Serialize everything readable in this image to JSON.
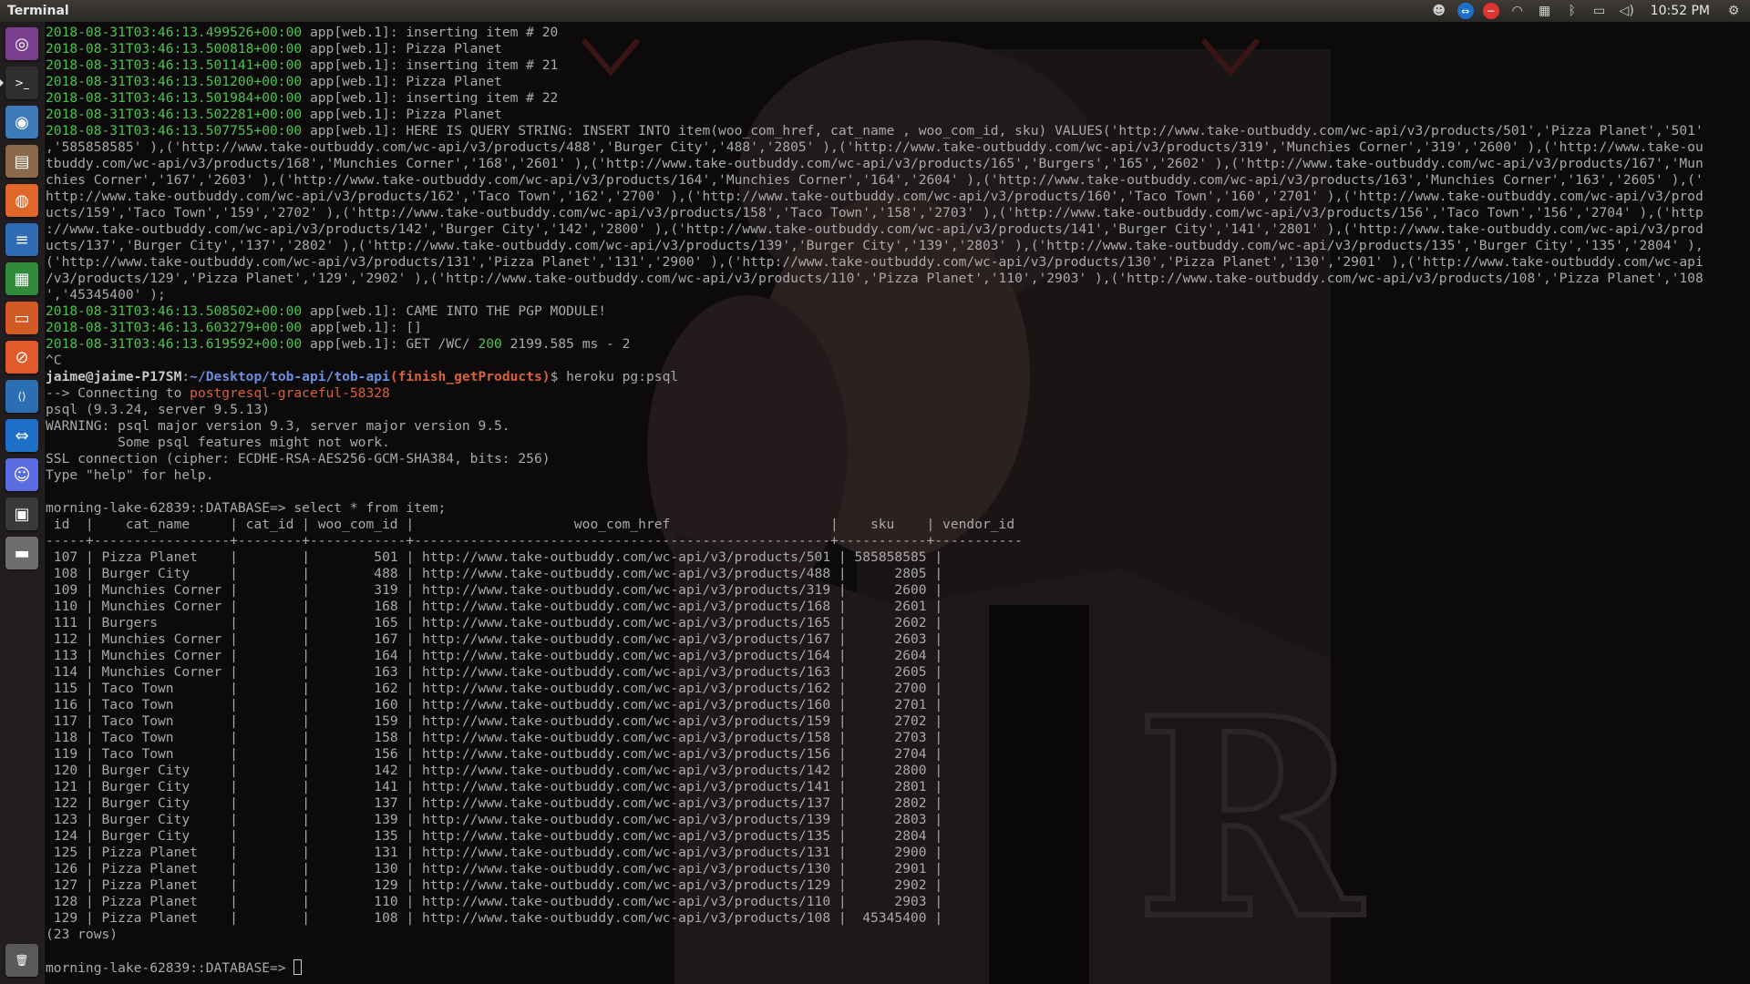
{
  "window": {
    "title": "Terminal"
  },
  "tray": {
    "clock": "10:52 PM"
  },
  "launcher": {
    "items": [
      {
        "name": "dash-icon",
        "color": "#7a3f8e",
        "glyph": "◎"
      },
      {
        "name": "terminal-icon",
        "color": "#2f2f2f",
        "glyph": ">_"
      },
      {
        "name": "chromium-icon",
        "color": "#3d7ab8",
        "glyph": "◉"
      },
      {
        "name": "files-icon",
        "color": "#8a6a4a",
        "glyph": "▤"
      },
      {
        "name": "firefox-icon",
        "color": "#e0662a",
        "glyph": "◍"
      },
      {
        "name": "writer-icon",
        "color": "#2e6db5",
        "glyph": "≡"
      },
      {
        "name": "calc-icon",
        "color": "#2f8b3b",
        "glyph": "▦"
      },
      {
        "name": "impress-icon",
        "color": "#d15a23",
        "glyph": "▭"
      },
      {
        "name": "compass-icon",
        "color": "#e25a2b",
        "glyph": "⊘"
      },
      {
        "name": "vscode-icon",
        "color": "#2a6fb4",
        "glyph": "⟨⟩"
      },
      {
        "name": "teamviewer-icon",
        "color": "#1d6fc8",
        "glyph": "⇔"
      },
      {
        "name": "discord-icon",
        "color": "#5b6ee1",
        "glyph": "☺"
      },
      {
        "name": "system-icon",
        "color": "#3a3a3a",
        "glyph": "▣"
      },
      {
        "name": "drive-icon",
        "color": "#6e6e6e",
        "glyph": "▬"
      },
      {
        "name": "trash-icon",
        "color": "#5a5a5a",
        "glyph": "🗑"
      }
    ]
  },
  "terminal": {
    "log_lines": [
      {
        "ts": "2018-08-31T03:46:13.499526+00:00",
        "rest": " app[web.1]: inserting item # 20"
      },
      {
        "ts": "2018-08-31T03:46:13.500818+00:00",
        "rest": " app[web.1]: Pizza Planet"
      },
      {
        "ts": "2018-08-31T03:46:13.501141+00:00",
        "rest": " app[web.1]: inserting item # 21"
      },
      {
        "ts": "2018-08-31T03:46:13.501200+00:00",
        "rest": " app[web.1]: Pizza Planet"
      },
      {
        "ts": "2018-08-31T03:46:13.501984+00:00",
        "rest": " app[web.1]: inserting item # 22"
      },
      {
        "ts": "2018-08-31T03:46:13.502281+00:00",
        "rest": " app[web.1]: Pizza Planet"
      },
      {
        "ts": "2018-08-31T03:46:13.507755+00:00",
        "rest": " app[web.1]: HERE IS QUERY STRING: INSERT INTO item(woo_com_href, cat_name , woo_com_id, sku) VALUES('http://www.take-outbuddy.com/wc-api/v3/products/501','Pizza Planet','501'"
      }
    ],
    "query_wrap": [
      ",'585858585' ),('http://www.take-outbuddy.com/wc-api/v3/products/488','Burger City','488','2805' ),('http://www.take-outbuddy.com/wc-api/v3/products/319','Munchies Corner','319','2600' ),('http://www.take-ou",
      "tbuddy.com/wc-api/v3/products/168','Munchies Corner','168','2601' ),('http://www.take-outbuddy.com/wc-api/v3/products/165','Burgers','165','2602' ),('http://www.take-outbuddy.com/wc-api/v3/products/167','Mun",
      "chies Corner','167','2603' ),('http://www.take-outbuddy.com/wc-api/v3/products/164','Munchies Corner','164','2604' ),('http://www.take-outbuddy.com/wc-api/v3/products/163','Munchies Corner','163','2605' ),('",
      "http://www.take-outbuddy.com/wc-api/v3/products/162','Taco Town','162','2700' ),('http://www.take-outbuddy.com/wc-api/v3/products/160','Taco Town','160','2701' ),('http://www.take-outbuddy.com/wc-api/v3/prod",
      "ucts/159','Taco Town','159','2702' ),('http://www.take-outbuddy.com/wc-api/v3/products/158','Taco Town','158','2703' ),('http://www.take-outbuddy.com/wc-api/v3/products/156','Taco Town','156','2704' ),('http",
      "://www.take-outbuddy.com/wc-api/v3/products/142','Burger City','142','2800' ),('http://www.take-outbuddy.com/wc-api/v3/products/141','Burger City','141','2801' ),('http://www.take-outbuddy.com/wc-api/v3/prod",
      "ucts/137','Burger City','137','2802' ),('http://www.take-outbuddy.com/wc-api/v3/products/139','Burger City','139','2803' ),('http://www.take-outbuddy.com/wc-api/v3/products/135','Burger City','135','2804' ),",
      "('http://www.take-outbuddy.com/wc-api/v3/products/131','Pizza Planet','131','2900' ),('http://www.take-outbuddy.com/wc-api/v3/products/130','Pizza Planet','130','2901' ),('http://www.take-outbuddy.com/wc-api",
      "/v3/products/129','Pizza Planet','129','2902' ),('http://www.take-outbuddy.com/wc-api/v3/products/110','Pizza Planet','110','2903' ),('http://www.take-outbuddy.com/wc-api/v3/products/108','Pizza Planet','108",
      "','45345400' );"
    ],
    "after_lines": [
      {
        "ts": "2018-08-31T03:46:13.508502+00:00",
        "rest": " app[web.1]: CAME INTO THE PGP MODULE!"
      },
      {
        "ts": "2018-08-31T03:46:13.603279+00:00",
        "rest": " app[web.1]: []"
      }
    ],
    "get_line": {
      "ts": "2018-08-31T03:46:13.619592+00:00",
      "pre": " app[web.1]: GET /WC/ ",
      "status": "200",
      "post": " 2199.585 ms - 2"
    },
    "interrupt": "^C",
    "prompt": {
      "user": "jaime@jaime-P17SM",
      "sep": ":",
      "path": "~/Desktop/tob-api/tob-api",
      "branch": "(finish_getProducts)",
      "dollar": "$ ",
      "command": "heroku pg:psql"
    },
    "connecting": {
      "pre": "--> Connecting to ",
      "db": "postgresql-graceful-58328"
    },
    "psql_lines": [
      "psql (9.3.24, server 9.5.13)",
      "WARNING: psql major version 9.3, server major version 9.5.",
      "         Some psql features might not work.",
      "SSL connection (cipher: ECDHE-RSA-AES256-GCM-SHA384, bits: 256)",
      "Type \"help\" for help.",
      ""
    ],
    "query_prompt": "morning-lake-62839::DATABASE=> select * from item;",
    "table": {
      "header": " id  |    cat_name     | cat_id | woo_com_id |                    woo_com_href                    |    sku    | vendor_id",
      "divider": "-----+-----------------+--------+------------+----------------------------------------------------+-----------+-----------",
      "columns": [
        "id",
        "cat_name",
        "cat_id",
        "woo_com_id",
        "woo_com_href",
        "sku",
        "vendor_id"
      ],
      "rows": [
        {
          "id": "107",
          "cat_name": "Pizza Planet",
          "cat_id": "",
          "woo_com_id": "501",
          "woo_com_href": "http://www.take-outbuddy.com/wc-api/v3/products/501",
          "sku": "585858585",
          "vendor_id": ""
        },
        {
          "id": "108",
          "cat_name": "Burger City",
          "cat_id": "",
          "woo_com_id": "488",
          "woo_com_href": "http://www.take-outbuddy.com/wc-api/v3/products/488",
          "sku": "2805",
          "vendor_id": ""
        },
        {
          "id": "109",
          "cat_name": "Munchies Corner",
          "cat_id": "",
          "woo_com_id": "319",
          "woo_com_href": "http://www.take-outbuddy.com/wc-api/v3/products/319",
          "sku": "2600",
          "vendor_id": ""
        },
        {
          "id": "110",
          "cat_name": "Munchies Corner",
          "cat_id": "",
          "woo_com_id": "168",
          "woo_com_href": "http://www.take-outbuddy.com/wc-api/v3/products/168",
          "sku": "2601",
          "vendor_id": ""
        },
        {
          "id": "111",
          "cat_name": "Burgers",
          "cat_id": "",
          "woo_com_id": "165",
          "woo_com_href": "http://www.take-outbuddy.com/wc-api/v3/products/165",
          "sku": "2602",
          "vendor_id": ""
        },
        {
          "id": "112",
          "cat_name": "Munchies Corner",
          "cat_id": "",
          "woo_com_id": "167",
          "woo_com_href": "http://www.take-outbuddy.com/wc-api/v3/products/167",
          "sku": "2603",
          "vendor_id": ""
        },
        {
          "id": "113",
          "cat_name": "Munchies Corner",
          "cat_id": "",
          "woo_com_id": "164",
          "woo_com_href": "http://www.take-outbuddy.com/wc-api/v3/products/164",
          "sku": "2604",
          "vendor_id": ""
        },
        {
          "id": "114",
          "cat_name": "Munchies Corner",
          "cat_id": "",
          "woo_com_id": "163",
          "woo_com_href": "http://www.take-outbuddy.com/wc-api/v3/products/163",
          "sku": "2605",
          "vendor_id": ""
        },
        {
          "id": "115",
          "cat_name": "Taco Town",
          "cat_id": "",
          "woo_com_id": "162",
          "woo_com_href": "http://www.take-outbuddy.com/wc-api/v3/products/162",
          "sku": "2700",
          "vendor_id": ""
        },
        {
          "id": "116",
          "cat_name": "Taco Town",
          "cat_id": "",
          "woo_com_id": "160",
          "woo_com_href": "http://www.take-outbuddy.com/wc-api/v3/products/160",
          "sku": "2701",
          "vendor_id": ""
        },
        {
          "id": "117",
          "cat_name": "Taco Town",
          "cat_id": "",
          "woo_com_id": "159",
          "woo_com_href": "http://www.take-outbuddy.com/wc-api/v3/products/159",
          "sku": "2702",
          "vendor_id": ""
        },
        {
          "id": "118",
          "cat_name": "Taco Town",
          "cat_id": "",
          "woo_com_id": "158",
          "woo_com_href": "http://www.take-outbuddy.com/wc-api/v3/products/158",
          "sku": "2703",
          "vendor_id": ""
        },
        {
          "id": "119",
          "cat_name": "Taco Town",
          "cat_id": "",
          "woo_com_id": "156",
          "woo_com_href": "http://www.take-outbuddy.com/wc-api/v3/products/156",
          "sku": "2704",
          "vendor_id": ""
        },
        {
          "id": "120",
          "cat_name": "Burger City",
          "cat_id": "",
          "woo_com_id": "142",
          "woo_com_href": "http://www.take-outbuddy.com/wc-api/v3/products/142",
          "sku": "2800",
          "vendor_id": ""
        },
        {
          "id": "121",
          "cat_name": "Burger City",
          "cat_id": "",
          "woo_com_id": "141",
          "woo_com_href": "http://www.take-outbuddy.com/wc-api/v3/products/141",
          "sku": "2801",
          "vendor_id": ""
        },
        {
          "id": "122",
          "cat_name": "Burger City",
          "cat_id": "",
          "woo_com_id": "137",
          "woo_com_href": "http://www.take-outbuddy.com/wc-api/v3/products/137",
          "sku": "2802",
          "vendor_id": ""
        },
        {
          "id": "123",
          "cat_name": "Burger City",
          "cat_id": "",
          "woo_com_id": "139",
          "woo_com_href": "http://www.take-outbuddy.com/wc-api/v3/products/139",
          "sku": "2803",
          "vendor_id": ""
        },
        {
          "id": "124",
          "cat_name": "Burger City",
          "cat_id": "",
          "woo_com_id": "135",
          "woo_com_href": "http://www.take-outbuddy.com/wc-api/v3/products/135",
          "sku": "2804",
          "vendor_id": ""
        },
        {
          "id": "125",
          "cat_name": "Pizza Planet",
          "cat_id": "",
          "woo_com_id": "131",
          "woo_com_href": "http://www.take-outbuddy.com/wc-api/v3/products/131",
          "sku": "2900",
          "vendor_id": ""
        },
        {
          "id": "126",
          "cat_name": "Pizza Planet",
          "cat_id": "",
          "woo_com_id": "130",
          "woo_com_href": "http://www.take-outbuddy.com/wc-api/v3/products/130",
          "sku": "2901",
          "vendor_id": ""
        },
        {
          "id": "127",
          "cat_name": "Pizza Planet",
          "cat_id": "",
          "woo_com_id": "129",
          "woo_com_href": "http://www.take-outbuddy.com/wc-api/v3/products/129",
          "sku": "2902",
          "vendor_id": ""
        },
        {
          "id": "128",
          "cat_name": "Pizza Planet",
          "cat_id": "",
          "woo_com_id": "110",
          "woo_com_href": "http://www.take-outbuddy.com/wc-api/v3/products/110",
          "sku": "2903",
          "vendor_id": ""
        },
        {
          "id": "129",
          "cat_name": "Pizza Planet",
          "cat_id": "",
          "woo_com_id": "108",
          "woo_com_href": "http://www.take-outbuddy.com/wc-api/v3/products/108",
          "sku": "45345400",
          "vendor_id": ""
        }
      ],
      "footer": "(23 rows)"
    },
    "final_prompt": "morning-lake-62839::DATABASE=> "
  },
  "colors": {
    "terminal_text": "#aaaaaa",
    "timestamp_green": "#4fc34f",
    "path_blue": "#6b8fe0",
    "branch_red": "#d9623d"
  }
}
